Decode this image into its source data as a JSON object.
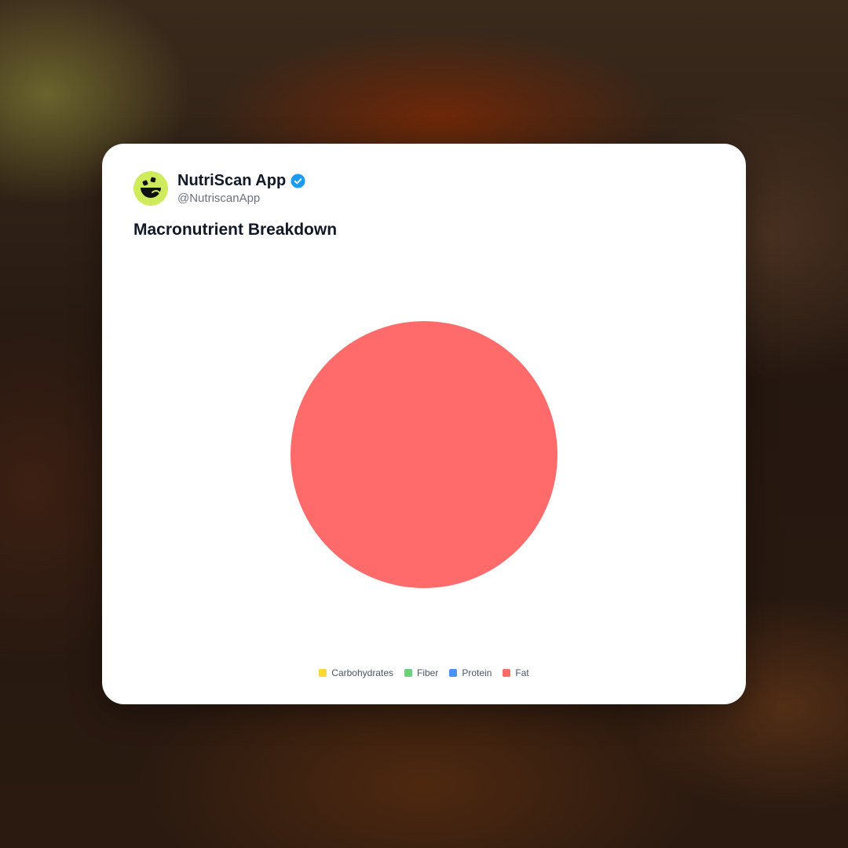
{
  "account": {
    "name": "NutriScan App",
    "handle": "@NutriscanApp",
    "verified": true,
    "avatar_icon": "nutriscan-logo-icon",
    "verified_icon": "verified-badge-icon",
    "avatar_color": "#cdeb5b",
    "verified_color": "#1d9bf0"
  },
  "chart_data": {
    "type": "pie",
    "title": "Macronutrient Breakdown",
    "categories": [
      "Carbohydrates",
      "Fiber",
      "Protein",
      "Fat"
    ],
    "values": [
      0,
      0,
      0,
      100
    ],
    "colors": [
      "#fdd835",
      "#6fcf7a",
      "#4f8ef7",
      "#ff6b6b"
    ],
    "legend_position": "bottom-center"
  }
}
